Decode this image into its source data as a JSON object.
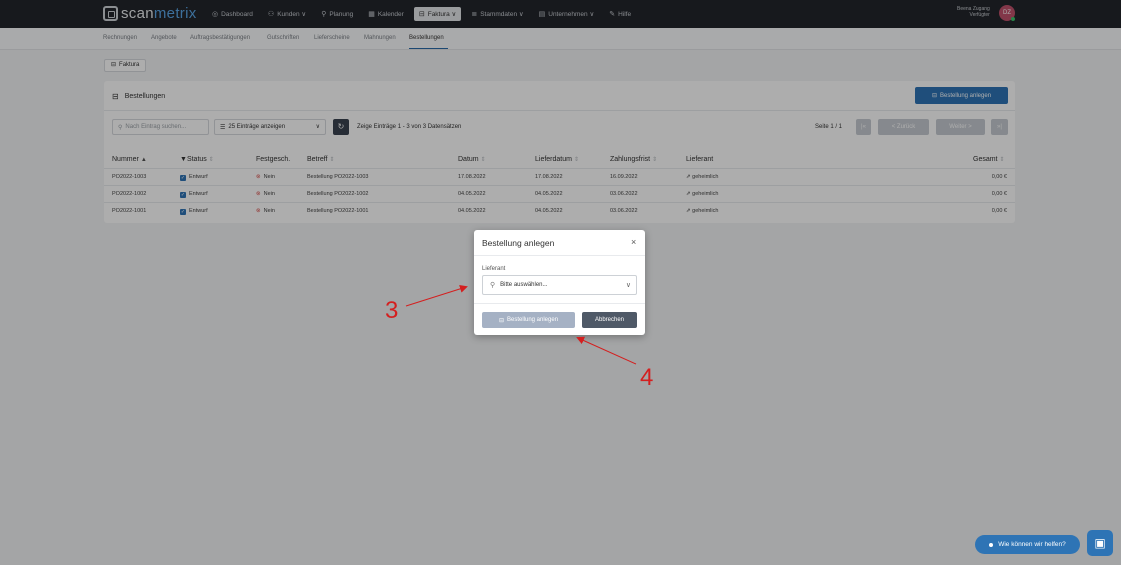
{
  "logo": {
    "part1": "scan",
    "part2": "metrix"
  },
  "nav": [
    {
      "icon": "◎",
      "label": "Dashboard"
    },
    {
      "icon": "⚇",
      "label": "Kunden ∨"
    },
    {
      "icon": "⚲",
      "label": "Planung"
    },
    {
      "icon": "▦",
      "label": "Kalender"
    },
    {
      "icon": "⊟",
      "label": "Faktura ∨",
      "active": true
    },
    {
      "icon": "≣",
      "label": "Stammdaten ∨"
    },
    {
      "icon": "▤",
      "label": "Unternehmen ∨"
    },
    {
      "icon": "✎",
      "label": "Hilfe"
    }
  ],
  "user": {
    "name": "Beena Zugang",
    "role": "Verfügter",
    "initials": "DZ"
  },
  "subnav": [
    "Rechnungen",
    "Angebote",
    "Auftragsbestätigungen",
    "Gutschriften",
    "Lieferscheine",
    "Mahnungen",
    "Bestellungen"
  ],
  "crumb": {
    "icon": "⊟",
    "label": "Faktura"
  },
  "card": {
    "title": "Bestellungen",
    "create_label": "Bestellung anlegen",
    "search_placeholder": "Nach Eintrag suchen...",
    "entries_label": "25 Einträge anzeigen",
    "record_info": "Zeige Einträge 1 - 3 von 3 Datensätzen",
    "page_info": "Seite 1 / 1",
    "prev_label": "< Zurück",
    "next_label": "Weiter >",
    "first_label": "|«",
    "last_label": "»|"
  },
  "table": {
    "headers": [
      "Nummer",
      "Status",
      "Festgesch.",
      "Betreff",
      "Datum",
      "Lieferdatum",
      "Zahlungsfrist",
      "Lieferant",
      "Gesamt"
    ],
    "rows": [
      {
        "nummer": "PO2022-1003",
        "status": "Entwurf",
        "fest": "Nein",
        "betreff": "Bestellung PO2022-1003",
        "datum": "17.08.2022",
        "liefer": "17.08.2022",
        "frist": "16.09.2022",
        "lieferant": "geheimlich",
        "gesamt": "0,00 €"
      },
      {
        "nummer": "PO2022-1002",
        "status": "Entwurf",
        "fest": "Nein",
        "betreff": "Bestellung PO2022-1002",
        "datum": "04.05.2022",
        "liefer": "04.05.2022",
        "frist": "03.06.2022",
        "lieferant": "geheimlich",
        "gesamt": "0,00 €"
      },
      {
        "nummer": "PO2022-1001",
        "status": "Entwurf",
        "fest": "Nein",
        "betreff": "Bestellung PO2022-1001",
        "datum": "04.05.2022",
        "liefer": "04.05.2022",
        "frist": "03.06.2022",
        "lieferant": "geheimlich",
        "gesamt": "0,00 €"
      }
    ]
  },
  "modal": {
    "title": "Bestellung anlegen",
    "field_label": "Lieferant",
    "select_placeholder": "Bitte auswählen...",
    "create_label": "Bestellung anlegen",
    "cancel_label": "Abbrechen"
  },
  "annotations": [
    "3",
    "4"
  ],
  "help": {
    "label": "Wie können wir helfen?"
  },
  "colors": {
    "primary": "#2e74b5",
    "topbar": "#22252b",
    "annotation": "#d41f1f"
  }
}
